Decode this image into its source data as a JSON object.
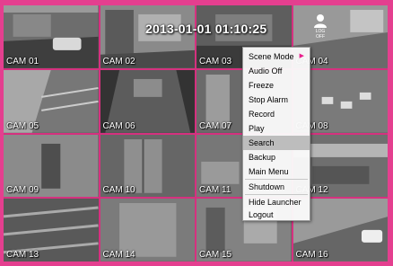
{
  "osd": {
    "datetime": "2013-01-01 01:10:25",
    "user_icon_label": "LOG OFF"
  },
  "cameras": [
    {
      "label": "CAM 01"
    },
    {
      "label": "CAM 02"
    },
    {
      "label": "CAM 03"
    },
    {
      "label": "CAM 04"
    },
    {
      "label": "CAM 05"
    },
    {
      "label": "CAM 06"
    },
    {
      "label": "CAM 07"
    },
    {
      "label": "CAM 08"
    },
    {
      "label": "CAM 09"
    },
    {
      "label": "CAM 10"
    },
    {
      "label": "CAM 11"
    },
    {
      "label": "CAM 12"
    },
    {
      "label": "CAM 13"
    },
    {
      "label": "CAM 14"
    },
    {
      "label": "CAM 15"
    },
    {
      "label": "CAM 16"
    }
  ],
  "menu": {
    "items": [
      {
        "label": "Scene Mode"
      },
      {
        "label": "Audio Off"
      },
      {
        "label": "Freeze"
      },
      {
        "label": "Stop Alarm"
      },
      {
        "label": "Record"
      },
      {
        "label": "Play"
      },
      {
        "label": "Search",
        "selected": true
      },
      {
        "label": "Backup"
      },
      {
        "label": "Main Menu"
      },
      {
        "label": "Shutdown"
      },
      {
        "label": "Hide Launcher"
      },
      {
        "label": "Logout"
      }
    ]
  },
  "colors": {
    "frame": "#e43f8f",
    "accent": "#e91e8c",
    "menu_bg": "#fafafa",
    "selected_bg": "#bdbdbd"
  }
}
